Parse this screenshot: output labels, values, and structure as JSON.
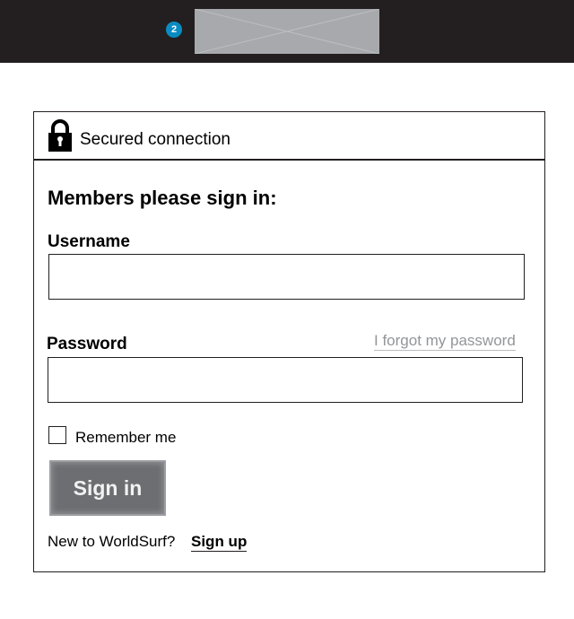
{
  "header": {
    "notification_count": "2",
    "logo_placeholder_icon": "image-placeholder-icon",
    "background_color": "#231f20",
    "badge_color": "#0a8bc2"
  },
  "panel": {
    "secure_icon": "lock-icon",
    "secure_label": "Secured connection",
    "heading": "Members please sign in:",
    "username": {
      "label": "Username",
      "value": ""
    },
    "password": {
      "label": "Password",
      "value": "",
      "forgot_link": "I forgot my password"
    },
    "remember": {
      "label": "Remember me",
      "checked": false
    },
    "signin_button": "Sign in",
    "signin_button_color": "#6d6e71",
    "signup_prompt": "New to WorldSurf?",
    "signup_link": "Sign up"
  }
}
